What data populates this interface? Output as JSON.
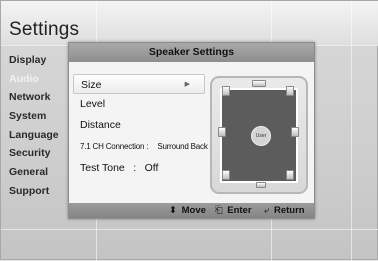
{
  "page": {
    "title": "Settings"
  },
  "side_menu": [
    {
      "label": "Display",
      "state": "normal"
    },
    {
      "label": "Audio",
      "state": "dim"
    },
    {
      "label": "Network",
      "state": "normal"
    },
    {
      "label": "System",
      "state": "normal"
    },
    {
      "label": "Language",
      "state": "normal"
    },
    {
      "label": "Security",
      "state": "normal"
    },
    {
      "label": "General",
      "state": "normal"
    },
    {
      "label": "Support",
      "state": "normal"
    }
  ],
  "dialog": {
    "title": "Speaker Settings",
    "options": {
      "size": "Size",
      "size_arrow_icon": "triangle-right-icon",
      "level": "Level",
      "distance": "Distance",
      "connection_label": "7.1 CH Connection :",
      "connection_value": "Surround Back",
      "test_tone_label": "Test Tone",
      "test_tone_sep": ":",
      "test_tone_value": "Off"
    },
    "room": {
      "listener_label": "User"
    },
    "footer": {
      "move": {
        "icon": "updown-arrow-icon",
        "glyph": "⬍",
        "label": "Move"
      },
      "enter": {
        "icon": "enter-icon",
        "glyph": "⎗",
        "label": "Enter"
      },
      "return": {
        "icon": "return-icon",
        "glyph": "⤶",
        "label": "Return"
      }
    }
  },
  "colors": {
    "dialog_header": "#9a9a9a",
    "room_floor": "#5c5c5c",
    "highlight": "#ffffff"
  }
}
